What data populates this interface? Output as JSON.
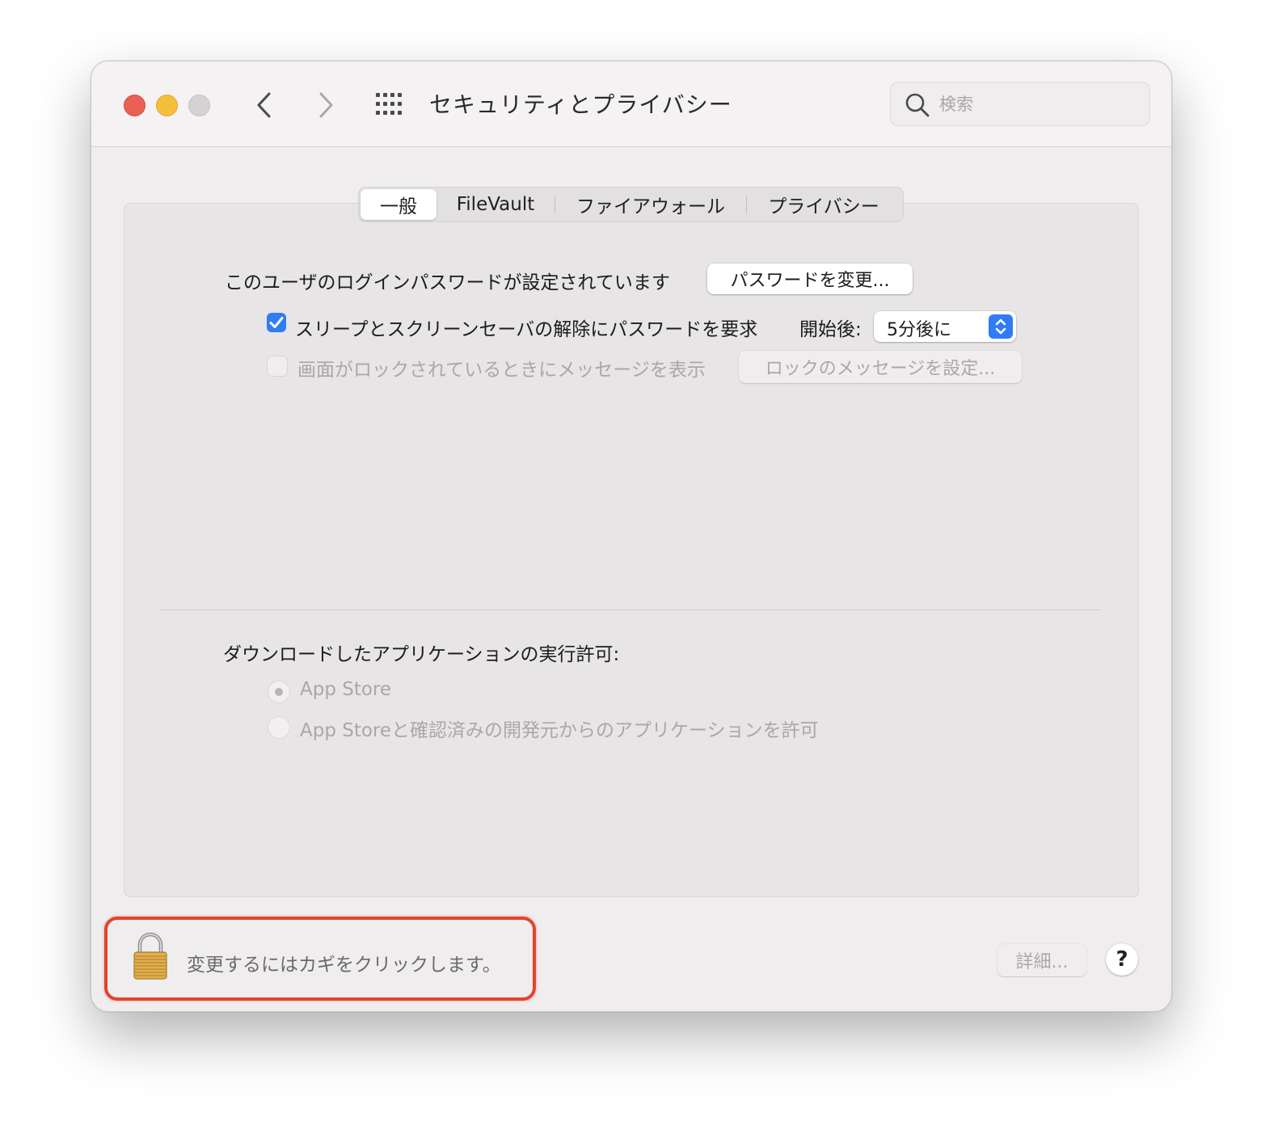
{
  "window": {
    "title": "セキュリティとプライバシー"
  },
  "search": {
    "placeholder": "検索"
  },
  "tabs": [
    {
      "label": "一般",
      "active": true
    },
    {
      "label": "FileVault",
      "active": false
    },
    {
      "label": "ファイアウォール",
      "active": false
    },
    {
      "label": "プライバシー",
      "active": false
    }
  ],
  "general": {
    "password_set_label": "このユーザのログインパスワードが設定されています",
    "change_password_button": "パスワードを変更...",
    "require_password": {
      "checked": true,
      "label": "スリープとスクリーンセーバの解除にパスワードを要求",
      "after_label": "開始後:",
      "delay_value": "5分後に"
    },
    "lock_message": {
      "checked": false,
      "label": "画面がロックされているときにメッセージを表示",
      "button": "ロックのメッセージを設定..."
    },
    "allow_apps": {
      "title": "ダウンロードしたアプリケーションの実行許可:",
      "options": [
        {
          "label": "App Store",
          "selected": true
        },
        {
          "label": "App Storeと確認済みの開発元からのアプリケーションを許可",
          "selected": false
        }
      ]
    }
  },
  "footer": {
    "lock_text": "変更するにはカギをクリックします。",
    "advanced_button": "詳細...",
    "help_button": "?"
  },
  "colors": {
    "accent": "#2f7cf6",
    "annotation": "#e2442f",
    "close": "#ec5f57",
    "minimize": "#f5be3b"
  }
}
